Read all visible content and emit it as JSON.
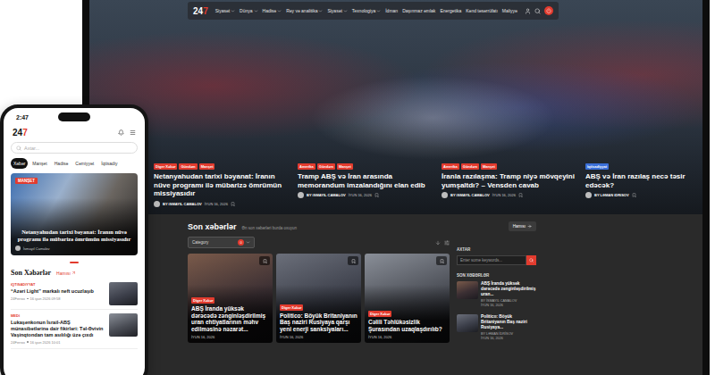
{
  "laptop": {
    "nav": {
      "logo": {
        "main": "24",
        "accent": "7"
      },
      "items": [
        {
          "label": "Siyasət",
          "expandable": true
        },
        {
          "label": "Dünya",
          "expandable": true
        },
        {
          "label": "Hadisə",
          "expandable": true
        },
        {
          "label": "Rəy və analitika",
          "expandable": true
        },
        {
          "label": "Siyasət",
          "expandable": true
        },
        {
          "label": "Texnologiya",
          "expandable": true
        },
        {
          "label": "İdman",
          "expandable": false
        },
        {
          "label": "Daşınmaz əmlak",
          "expandable": false
        },
        {
          "label": "Energetika",
          "expandable": false
        },
        {
          "label": "Kənd təsərrüfatı",
          "expandable": false
        },
        {
          "label": "Maliyyə",
          "expandable": false
        }
      ]
    },
    "hero": [
      {
        "tags": [
          {
            "label": "Diger Xəbər",
            "color": "#e23b2e"
          },
          {
            "label": "Gündəm",
            "color": "#e23b2e"
          },
          {
            "label": "Manşet",
            "color": "#e23b2e"
          }
        ],
        "title": "Netanyahudan tarixi bəyanat: İranın nüve programı ilə mübarizə ömrümün missiyasıdır",
        "author": "BY İSMAYIL CAMALOV",
        "date": "İYUN 16, 2026"
      },
      {
        "tags": [
          {
            "label": "Amerika",
            "color": "#e23b2e"
          },
          {
            "label": "Gündəm",
            "color": "#e23b2e"
          },
          {
            "label": "Manşet",
            "color": "#e23b2e"
          }
        ],
        "title": "Tramp ABŞ və İran arasında memorandum imzalandığını elan edib",
        "author": "BY İSMAYIL CAMALOV",
        "date": "İYUN 16, 2026"
      },
      {
        "tags": [
          {
            "label": "Amerika",
            "color": "#e23b2e"
          },
          {
            "label": "Gündəm",
            "color": "#e23b2e"
          },
          {
            "label": "Manşet",
            "color": "#e23b2e"
          }
        ],
        "title": "İranla razılaşma: Tramp niyə mövqeyini yumşaltdı? – Vensden cavab",
        "author": "BY İSMAYIL CAMALOV",
        "date": "İYUN 16, 2026"
      },
      {
        "tags": [
          {
            "label": "İqtisadiyyat",
            "color": "#3a6fd8"
          }
        ],
        "title": "ABŞ və İran razılaş necə təsir edəcək?",
        "author": "BY LƏMAN İDRİSOV",
        "date": ""
      }
    ],
    "latest": {
      "title": "Son xəbərlər",
      "subtitle": "Ən son xəbərləri burda oxuyun",
      "all_button": "Hamısı",
      "category": {
        "label": "Category",
        "badge": "0"
      },
      "cards": [
        {
          "tag": "Diger Xəbər",
          "title": "ABŞ İranda yüksək dərəcədə zənginləşdirilmiş uran ehtiyatlarının məhv edilməsinə nəzarət...",
          "date": "İYUN 16, 2026"
        },
        {
          "tag": "Diger Xəbər",
          "title": "Politico: Böyük Britaniyanın Baş naziri Rusiyaya qarşı yeni enerji sanksiyaları...",
          "date": "İYUN 16, 2026"
        },
        {
          "tag": "Diger Xəbər",
          "title": "Cəlili Təhlükəsizlik Şurasından uzaqlaşdırılıb?",
          "date": "İYUN 16, 2026"
        }
      ],
      "sidebar": {
        "search_title": "AXTAR",
        "search_placeholder": "Enter some keywords...",
        "news_title": "SON XƏBƏRLƏR",
        "items": [
          {
            "title": "ABŞ İranda yüksək dərəcədə zənginləşdirilmiş uran...",
            "author": "BY İSMAYIL CAMALOV",
            "date": "İYUN 16, 2026"
          },
          {
            "title": "Politico: Böyük Britaniyanın Baş naziri Rusiyaya...",
            "author": "BY LƏMAN İDRİSOV",
            "date": "İYUN 16, 2026"
          }
        ]
      }
    }
  },
  "phone": {
    "time": "2:47",
    "logo": {
      "main": "24",
      "accent": "7"
    },
    "search_placeholder": "Axtar...",
    "tabs": [
      {
        "label": "Xəbər",
        "selected": true
      },
      {
        "label": "Manşet",
        "selected": false
      },
      {
        "label": "Hadisə",
        "selected": false
      },
      {
        "label": "Cəmiyyət",
        "selected": false
      },
      {
        "label": "İqtisadiy",
        "selected": false
      }
    ],
    "hero": {
      "tag": "MANŞET",
      "title": "Netanyahudan tarixi bəyanat: İranın nüvə programı ilə mübarizə ömrümün missiyasıdır",
      "author": "İsmayıl Camalov"
    },
    "section": {
      "title": "Son Xəbərlər",
      "link": "Hamısı"
    },
    "news": [
      {
        "tag": "İQTİSADİYYAT",
        "title": "“Azəri Light” markalı neft ucuzlaşıb",
        "author": "24Ferrox",
        "date": "16 iyun 2026 09:58"
      },
      {
        "tag": "MEDİ",
        "title": "Lukaşenkonun İsrail-ABŞ münasibətlərinə dair fikirləri: Təl-Əvivin Vaşinqtondan tam asılılığı üzə çıxdı",
        "author": "24Ferrox",
        "date": "16 iyun 2026 10:01"
      }
    ]
  }
}
